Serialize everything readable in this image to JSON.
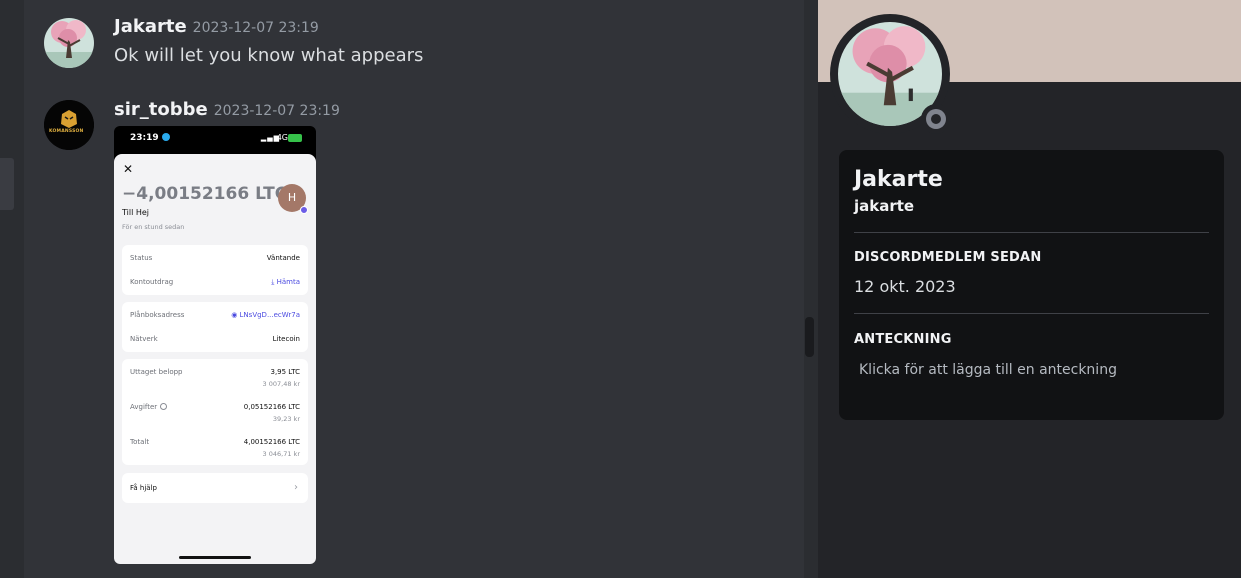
{
  "messages": [
    {
      "author": "Jakarte",
      "timestamp": "2023-12-07 23:19",
      "text": "Ok will let you know what appears"
    },
    {
      "author": "sir_tobbe",
      "timestamp": "2023-12-07 23:19",
      "avatar_text": "KOMANSSON"
    }
  ],
  "attachment": {
    "status_time": "23:19",
    "network": "4G",
    "close_symbol": "✕",
    "amount": "−4,00152166 LTC",
    "recipient": "Till Hej",
    "when": "För en stund sedan",
    "avatar_letter": "H",
    "rows": {
      "status_label": "Status",
      "status_value": "Väntande",
      "statement_label": "Kontoutdrag",
      "statement_value": "⤓ Hämta",
      "address_label": "Plånboksadress",
      "address_value": "◉ LNsVgD...ecWr7a",
      "network_label": "Nätverk",
      "network_value": "Litecoin",
      "withdrawn_label": "Uttaget belopp",
      "withdrawn_value": "3,95 LTC",
      "withdrawn_fiat": "3 007,48 kr",
      "fees_label": "Avgifter",
      "fees_value": "0,05152166 LTC",
      "fees_fiat": "39,23 kr",
      "total_label": "Totalt",
      "total_value": "4,00152166 LTC",
      "total_fiat": "3 046,71 kr",
      "help_label": "Få hjälp",
      "help_chevron": "›"
    }
  },
  "profile": {
    "display_name": "Jakarte",
    "username": "jakarte",
    "member_since_heading": "DISCORDMEDLEM SEDAN",
    "member_since_value": "12 okt. 2023",
    "note_heading": "ANTECKNING",
    "note_placeholder": "Klicka för att lägga till en anteckning"
  },
  "colors": {
    "chat_bg": "#313338",
    "panel_bg": "#232428",
    "card_bg": "#111214",
    "banner": "#d2c2ba",
    "status_offline": "#80848e"
  }
}
